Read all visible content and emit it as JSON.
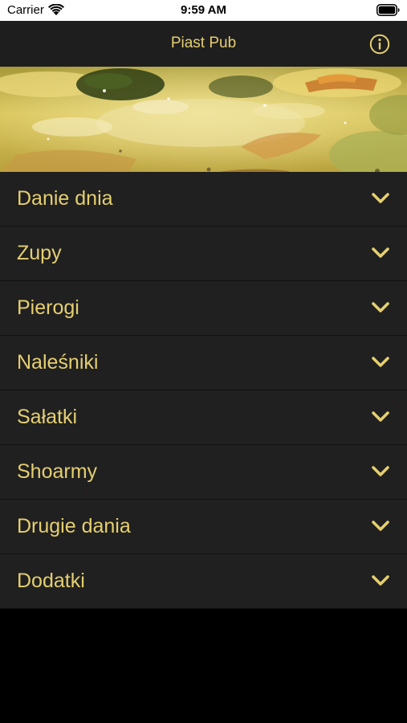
{
  "status_bar": {
    "carrier": "Carrier",
    "time": "9:59 AM"
  },
  "nav": {
    "title": "Piast Pub",
    "info_icon": "info-circle-icon"
  },
  "hero": {
    "image": "food-photo"
  },
  "menu": {
    "items": [
      {
        "label": "Danie dnia"
      },
      {
        "label": "Zupy"
      },
      {
        "label": "Pierogi"
      },
      {
        "label": "Naleśniki"
      },
      {
        "label": "Sałatki"
      },
      {
        "label": "Shoarmy"
      },
      {
        "label": "Drugie dania"
      },
      {
        "label": "Dodatki"
      }
    ],
    "expand_icon": "chevron-down-icon"
  },
  "theme": {
    "accent": "#e5cf6f",
    "nav_background": "#1e1e1e",
    "row_background": "#202020",
    "page_background": "#000000"
  }
}
